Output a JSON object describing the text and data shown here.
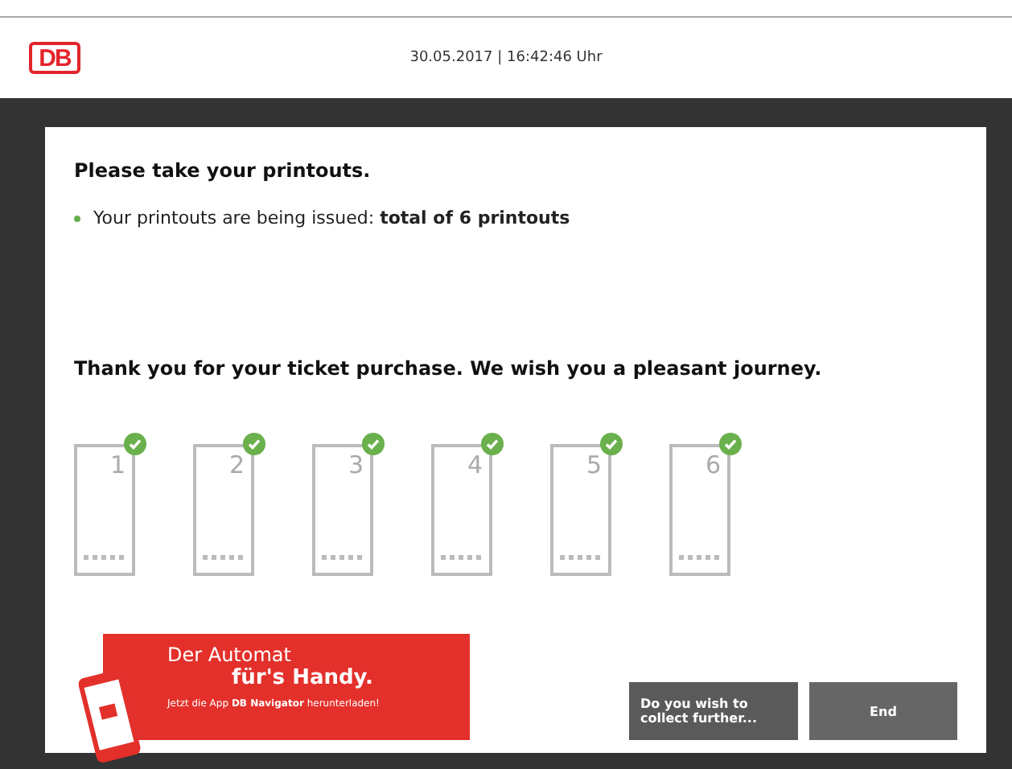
{
  "header": {
    "logo": "DB",
    "datetime": "30.05.2017 | 16:42:46 Uhr"
  },
  "dialog": {
    "title": "Please take your printouts.",
    "bullets": [
      "Your printouts are being issued: **total of 6 printouts**"
    ],
    "thanks": "Thank you for your ticket purchase. We wish you a pleasant journey.",
    "printouts": [
      {
        "number": "1",
        "done": true
      },
      {
        "number": "2",
        "done": true
      },
      {
        "number": "3",
        "done": true
      },
      {
        "number": "4",
        "done": true
      },
      {
        "number": "5",
        "done": true
      },
      {
        "number": "6",
        "done": true
      }
    ],
    "banner": {
      "line1": "Der Automat",
      "line2": "für's Handy.",
      "line3": "Jetzt die App **DB Navigator** herunterladen!"
    },
    "buttons": [
      {
        "label": "Do you wish to collect further...",
        "kind": "secondary"
      },
      {
        "label": "End",
        "kind": "primary"
      }
    ]
  }
}
